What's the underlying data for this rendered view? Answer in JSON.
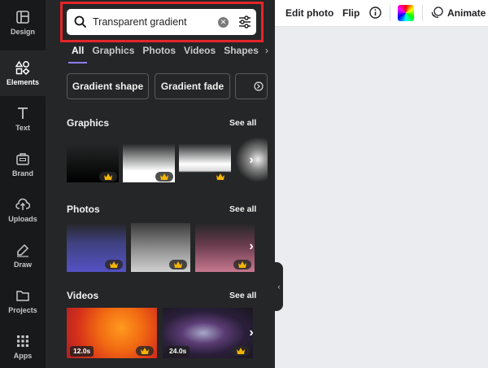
{
  "rail": [
    {
      "label": "Design",
      "icon": "design-icon"
    },
    {
      "label": "Elements",
      "icon": "elements-icon"
    },
    {
      "label": "Text",
      "icon": "text-icon"
    },
    {
      "label": "Brand",
      "icon": "brand-icon"
    },
    {
      "label": "Uploads",
      "icon": "uploads-icon"
    },
    {
      "label": "Draw",
      "icon": "draw-icon"
    },
    {
      "label": "Projects",
      "icon": "projects-icon"
    },
    {
      "label": "Apps",
      "icon": "apps-icon"
    }
  ],
  "search": {
    "value": "Transparent gradient"
  },
  "tabs": [
    "All",
    "Graphics",
    "Photos",
    "Videos",
    "Shapes"
  ],
  "chips": [
    "Gradient shape",
    "Gradient fade"
  ],
  "sections": {
    "graphics": {
      "title": "Graphics",
      "see_all": "See all"
    },
    "photos": {
      "title": "Photos",
      "see_all": "See all"
    },
    "videos": {
      "title": "Videos",
      "see_all": "See all"
    }
  },
  "videos": [
    {
      "duration": "12.0s"
    },
    {
      "duration": "24.0s"
    }
  ],
  "toolbar": {
    "edit_photo": "Edit photo",
    "flip": "Flip",
    "animate": "Animate"
  },
  "colors": {
    "highlight": "#e3262a",
    "accent": "#8b7ef5",
    "panel": "#252627",
    "rail": "#18191b",
    "crown": "#f5b400"
  }
}
